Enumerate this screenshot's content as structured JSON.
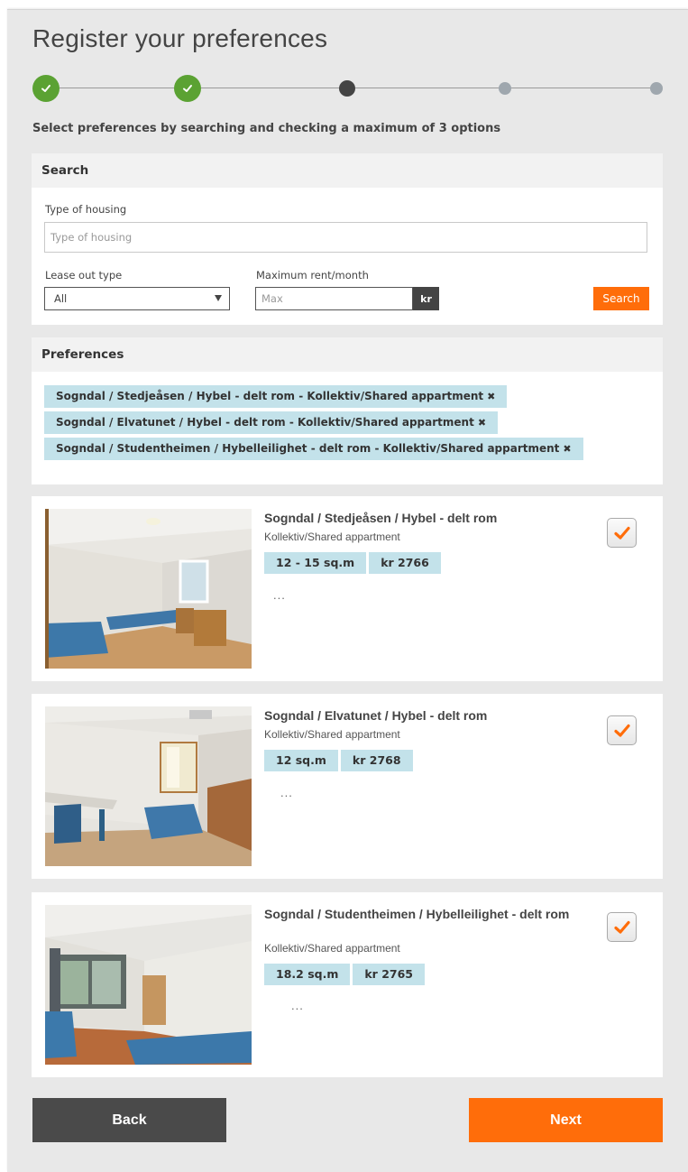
{
  "header": {
    "title": "Register your preferences"
  },
  "stepper": {
    "steps": [
      {
        "state": "done",
        "icon": "check-icon"
      },
      {
        "state": "done",
        "icon": "check-icon"
      },
      {
        "state": "current"
      },
      {
        "state": "todo"
      },
      {
        "state": "todo"
      }
    ]
  },
  "instruction": "Select preferences by searching and checking a maximum of 3 options",
  "search": {
    "heading": "Search",
    "housing_label": "Type of housing",
    "housing_placeholder": "Type of housing",
    "lease_label": "Lease out type",
    "lease_value": "All",
    "rent_label": "Maximum rent/month",
    "rent_placeholder": "Max",
    "currency": "kr",
    "button": "Search"
  },
  "preferences": {
    "heading": "Preferences",
    "remove_glyph": "✖",
    "tags": [
      "Sogndal / Stedjeåsen / Hybel - delt rom - Kollektiv/Shared appartment",
      "Sogndal / Elvatunet / Hybel - delt rom - Kollektiv/Shared appartment",
      "Sogndal / Studentheimen / Hybelleilighet - delt rom - Kollektiv/Shared appartment"
    ]
  },
  "listings": [
    {
      "title": "Sogndal / Stedjeåsen / Hybel - delt rom",
      "subtitle": "Kollektiv/Shared appartment",
      "size": "12 - 15 sq.m",
      "price": "kr 2766",
      "more": "...",
      "checked": true
    },
    {
      "title": "Sogndal / Elvatunet / Hybel - delt rom",
      "subtitle": "Kollektiv/Shared appartment",
      "size": "12 sq.m",
      "price": "kr 2768",
      "more": "...",
      "checked": true
    },
    {
      "title": "Sogndal / Studentheimen / Hybelleilighet - delt rom",
      "subtitle": "Kollektiv/Shared appartment",
      "size": "18.2 sq.m",
      "price": "kr 2765",
      "more": "...",
      "checked": true
    }
  ],
  "nav": {
    "back": "Back",
    "next": "Next"
  },
  "colors": {
    "accent": "#ff6d0a",
    "success": "#5ba233",
    "tag_bg": "#c3e2ea",
    "dark_button": "#4a4a4a"
  }
}
